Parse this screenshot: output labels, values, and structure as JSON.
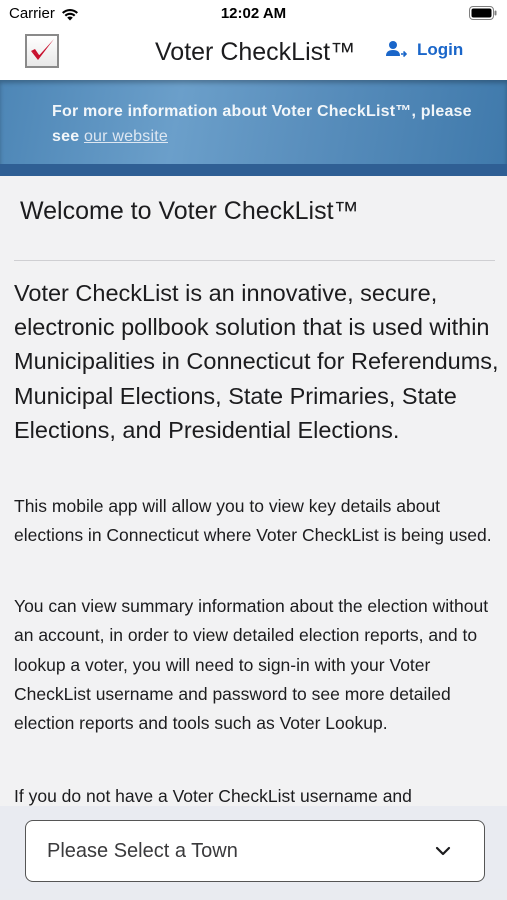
{
  "status_bar": {
    "carrier": "Carrier",
    "time": "12:02 AM",
    "icons": [
      "wifi-icon",
      "battery-icon"
    ]
  },
  "nav": {
    "title": "Voter CheckList™",
    "login_label": "Login",
    "logo_icon": "checkmark-logo-icon",
    "login_icon": "user-icon"
  },
  "banner": {
    "text": "For more information about Voter CheckList™, please see ",
    "link_label": "our website"
  },
  "content": {
    "heading": "Welcome to Voter CheckList™",
    "lead": "Voter CheckList is an innovative, secure, electronic pollbook solution that is used within Municipalities in Connecticut for Referendums, Municipal Elections, State Primaries, State Elections, and Presidential Elections.",
    "paragraphs": [
      "This mobile app will allow you to view key details about elections in Connecticut where Voter CheckList is being used.",
      "You can view summary information about the election without an account, in order to view detailed election reports, and to lookup a voter, you will need to sign-in with your Voter CheckList username and password to see more detailed election reports and tools such as Voter Lookup.",
      "If you do not have a Voter CheckList username and"
    ]
  },
  "town_select": {
    "placeholder": "Please Select a Town",
    "icon": "chevron-down-icon"
  },
  "colors": {
    "accent": "#1a66c9",
    "banner": "#5a8fbd",
    "banner_dark": "#2f5f94",
    "logo_check": "#c8102e"
  }
}
